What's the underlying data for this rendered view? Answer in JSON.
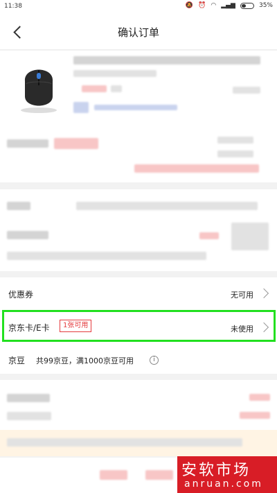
{
  "status_bar": {
    "time": "11:38",
    "battery": "35%"
  },
  "header": {
    "title": "确认订单"
  },
  "coupon_row": {
    "label": "优惠券",
    "value": "无可用"
  },
  "jd_card_row": {
    "label": "京东卡/E卡",
    "badge": "1张可用",
    "value": "未使用"
  },
  "jd_beans_row": {
    "label": "京豆",
    "detail": "共99京豆，满1000京豆可用",
    "info_icon": "i"
  },
  "watermark": {
    "line1": "安软市场",
    "line2": "anruan.com"
  },
  "colors": {
    "accent": "#e4393c",
    "highlight": "#22e01f",
    "watermark": "#d81d26"
  }
}
